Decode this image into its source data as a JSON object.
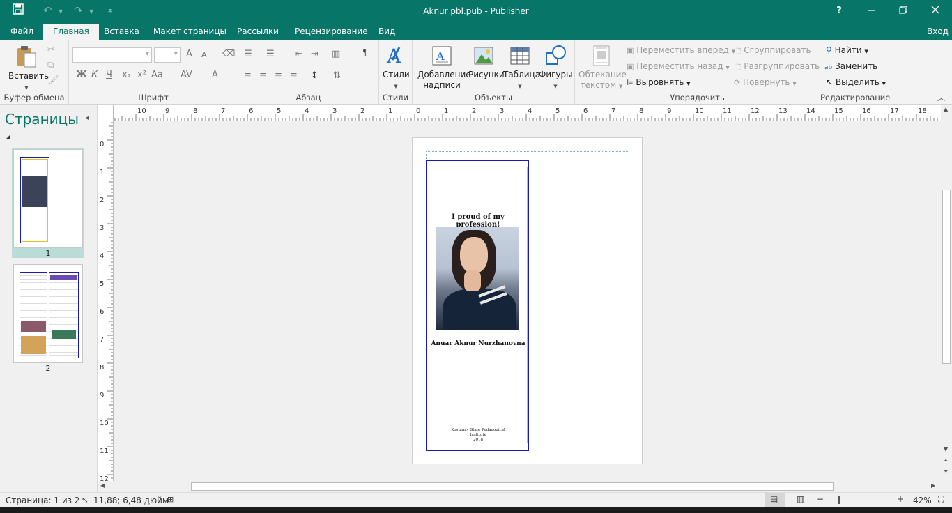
{
  "window": {
    "title": "Aknur pbl.pub - Publisher",
    "help": "?",
    "login": "Вход"
  },
  "tabs": [
    {
      "label": "Файл"
    },
    {
      "label": "Главная"
    },
    {
      "label": "Вставка"
    },
    {
      "label": "Макет страницы"
    },
    {
      "label": "Рассылки"
    },
    {
      "label": "Рецензирование"
    },
    {
      "label": "Вид"
    }
  ],
  "ribbon": {
    "clipboard": {
      "label": "Буфер обмена",
      "paste": "Вставить"
    },
    "font": {
      "label": "Шрифт",
      "bold": "Ж",
      "italic": "К",
      "underline": "Ч",
      "sub": "x₂",
      "sup": "x²",
      "case": "Aa",
      "spacing": "AV",
      "color": "A",
      "grow": "A",
      "shrink": "A"
    },
    "paragraph": {
      "label": "Абзац",
      "pilcrow": "¶"
    },
    "styles": {
      "label": "Стили",
      "button": "Стили"
    },
    "objects": {
      "label": "Объекты",
      "textbox_line1": "Добавление",
      "textbox_line2": "надписи",
      "pictures": "Рисунки",
      "table": "Таблица",
      "shapes": "Фигуры"
    },
    "arrange": {
      "label": "Упорядочить",
      "wrap_line1": "Обтекание",
      "wrap_line2": "текстом",
      "forward": "Переместить вперед",
      "backward": "Переместить назад",
      "align": "Выровнять",
      "group": "Сгруппировать",
      "ungroup": "Разгруппировать",
      "rotate": "Повернуть"
    },
    "editing": {
      "label": "Редактирование",
      "find": "Найти",
      "replace": "Заменить",
      "select": "Выделить"
    }
  },
  "pages_pane": {
    "title": "Страницы",
    "pages": [
      {
        "num": "1"
      },
      {
        "num": "2"
      }
    ]
  },
  "ruler": {
    "h_labels": [
      "10",
      "9",
      "8",
      "7",
      "6",
      "5",
      "4",
      "3",
      "2",
      "1",
      "0",
      "1",
      "2",
      "3",
      "4",
      "5",
      "6",
      "7",
      "8",
      "9",
      "10",
      "11",
      "12",
      "13",
      "14",
      "15",
      "16",
      "17",
      "18"
    ],
    "v_labels": [
      "0",
      "1",
      "2",
      "3",
      "4",
      "5",
      "6",
      "7",
      "8",
      "9",
      "10",
      "11",
      "12"
    ]
  },
  "document": {
    "heading": "I proud of my profession!",
    "name": "Anuar Aknur Nurzhanovna",
    "footer_line1": "Kostanay State Pedagogical",
    "footer_line2": "Institute",
    "footer_line3": "2018",
    "colors": {
      "outer_border": "#1a1ab0",
      "inner_border": "#e8c21a",
      "accent": "#077568"
    }
  },
  "status": {
    "page": "Страница: 1 из 2",
    "coords": "11,88; 6,48 дюйм",
    "zoom": "42%"
  }
}
